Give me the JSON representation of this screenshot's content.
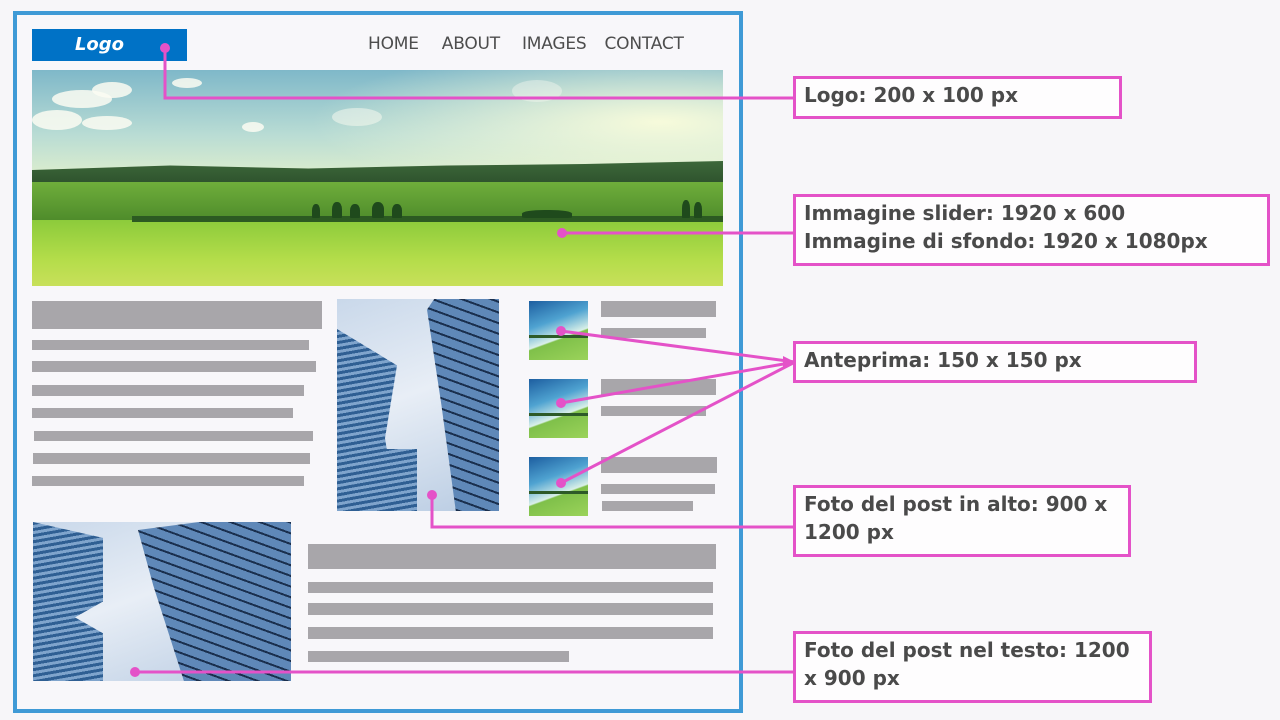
{
  "mockup": {
    "logo_text": "Logo",
    "nav": [
      "HOME",
      "ABOUT",
      "IMAGES",
      "CONTACT"
    ],
    "colors": {
      "frame_border": "#3f9ad6",
      "logo_bg": "#0072c6",
      "placeholder_bar": "#a8a6aa",
      "callout": "#e452c8"
    }
  },
  "annotations": [
    {
      "id": "logo",
      "text": "Logo: 200 x 100 px"
    },
    {
      "id": "slider",
      "lines": [
        "Immagine slider: 1920 x 600",
        "Immagine di sfondo: 1920 x 1080px"
      ]
    },
    {
      "id": "thumbnail",
      "text": "Anteprima: 150 x 150 px"
    },
    {
      "id": "featured",
      "lines": [
        "Foto del post in alto: 900 x",
        "1200 px"
      ]
    },
    {
      "id": "inline",
      "lines": [
        "Foto del post nel testo: 1200",
        "x 900 px"
      ]
    }
  ]
}
